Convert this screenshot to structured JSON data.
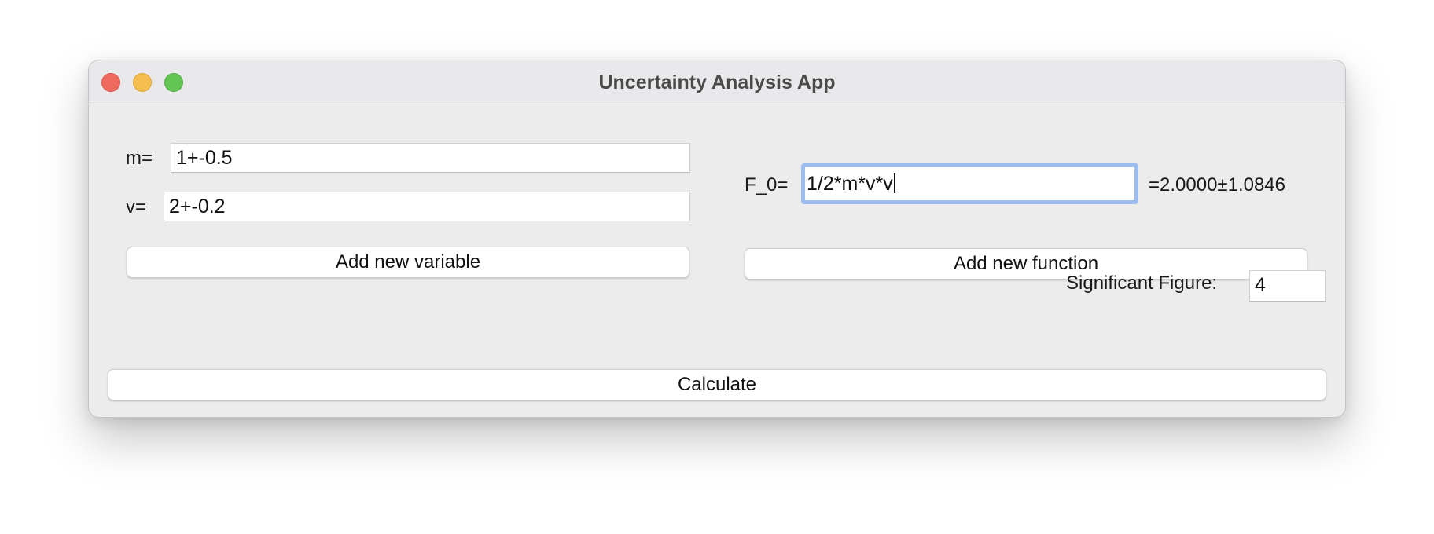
{
  "window": {
    "title": "Uncertainty Analysis App"
  },
  "variables": [
    {
      "label": "m=",
      "value": "1+-0.5"
    },
    {
      "label": "v=",
      "value": "2+-0.2"
    }
  ],
  "add_variable_label": "Add new variable",
  "functions": [
    {
      "label": "F_0=",
      "value": "1/2*m*v*v",
      "result": "=2.0000±1.0846"
    }
  ],
  "add_function_label": "Add new function",
  "significant_figure": {
    "label": "Significant Figure:",
    "value": "4"
  },
  "calculate_label": "Calculate",
  "colors": {
    "close": "#ee6a5f",
    "minimize": "#f5be4f",
    "zoom": "#62c554",
    "focus_ring": "#9dbdf0"
  }
}
